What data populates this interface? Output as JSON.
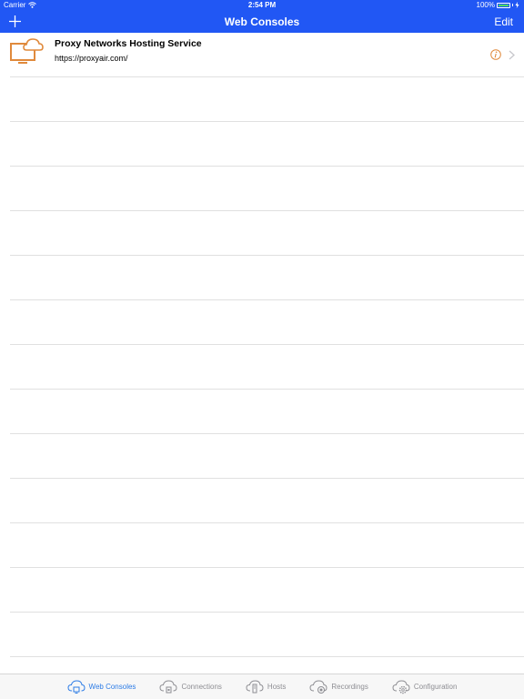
{
  "status_bar": {
    "carrier": "Carrier",
    "time": "2:54 PM",
    "battery": "100%"
  },
  "nav_bar": {
    "title": "Web Consoles",
    "edit_label": "Edit"
  },
  "consoles": [
    {
      "name": "Proxy Networks Hosting Service",
      "url": "https://proxyair.com/"
    }
  ],
  "tab_bar": {
    "tabs": [
      {
        "label": "Web Consoles",
        "icon": "web-consoles-icon",
        "active": true
      },
      {
        "label": "Connections",
        "icon": "connections-icon",
        "active": false
      },
      {
        "label": "Hosts",
        "icon": "hosts-icon",
        "active": false
      },
      {
        "label": "Recordings",
        "icon": "recordings-icon",
        "active": false
      },
      {
        "label": "Configuration",
        "icon": "configuration-icon",
        "active": false
      }
    ]
  },
  "colors": {
    "accent": "#2157f4",
    "brand_orange": "#e08a3c",
    "tab_active": "#2d7ce6"
  }
}
